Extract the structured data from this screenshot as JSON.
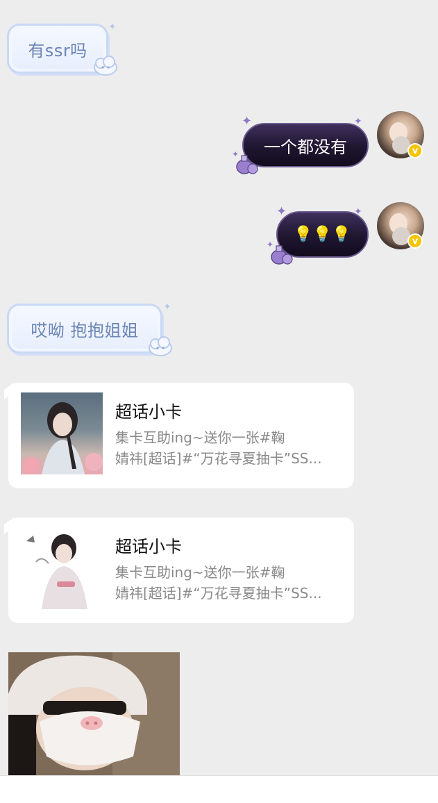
{
  "messages": {
    "m1": {
      "text": "有ssr吗",
      "side": "incoming"
    },
    "m2": {
      "text": "一个都没有",
      "side": "outgoing"
    },
    "m3": {
      "text": "💡💡💡",
      "side": "outgoing",
      "emoji_name": "lightbulb-icon"
    },
    "m4": {
      "text": "哎呦 抱抱姐姐",
      "side": "incoming"
    },
    "card1": {
      "title": "超话小卡",
      "desc_line1": "集卡互助ing~送你一张#鞠",
      "desc_line2": "婧祎[超话]#“万花寻夏抽卡”SS..."
    },
    "card2": {
      "title": "超话小卡",
      "desc_line1": "集卡互助ing~送你一张#鞠",
      "desc_line2": "婧祎[超话]#“万花寻夏抽卡”SS..."
    }
  },
  "badge": {
    "verified_mark": "v"
  },
  "colors": {
    "background": "#ededed",
    "incoming_text": "#6b85b5",
    "outgoing_bubble": "#1f1630",
    "verified": "#f7c400",
    "card_desc": "#8a8a8a"
  }
}
